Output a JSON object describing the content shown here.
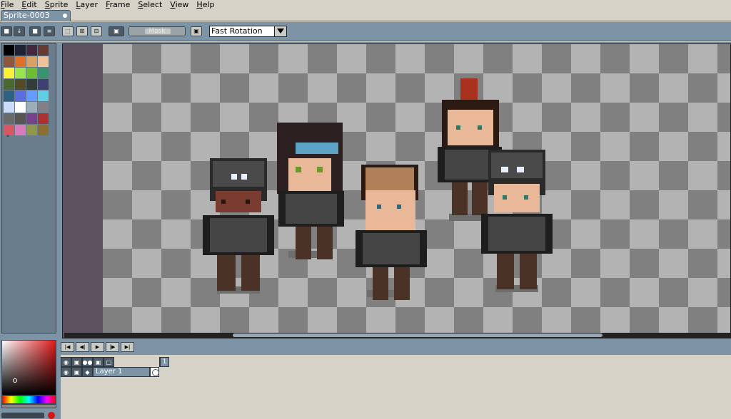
{
  "menu": [
    "File",
    "Edit",
    "Sprite",
    "Layer",
    "Frame",
    "Select",
    "View",
    "Help"
  ],
  "tab": {
    "title": "Sprite-0003"
  },
  "toolbar": {
    "mask_label": "Mask",
    "rotation_algorithm": "Fast Rotation"
  },
  "palette": {
    "colors": [
      "#000000",
      "#222034",
      "#45283c",
      "#663931",
      "#8f563b",
      "#df7126",
      "#d9a066",
      "#eec39a",
      "#fbf236",
      "#99e550",
      "#6abe30",
      "#37946e",
      "#4b692f",
      "#524b24",
      "#323c39",
      "#3f3f74",
      "#306082",
      "#5b6ee1",
      "#639bff",
      "#5fcde4",
      "#cbdbfc",
      "#ffffff",
      "#9badb7",
      "#847e87",
      "#696a6a",
      "#595652",
      "#76428a",
      "#ac3232",
      "#d95763",
      "#d77bba",
      "#8f974a",
      "#8a6f30"
    ],
    "more_indicator": "\""
  },
  "timeline": {
    "frame_number": "1",
    "layers": [
      {
        "name": "Layer 1"
      }
    ]
  }
}
